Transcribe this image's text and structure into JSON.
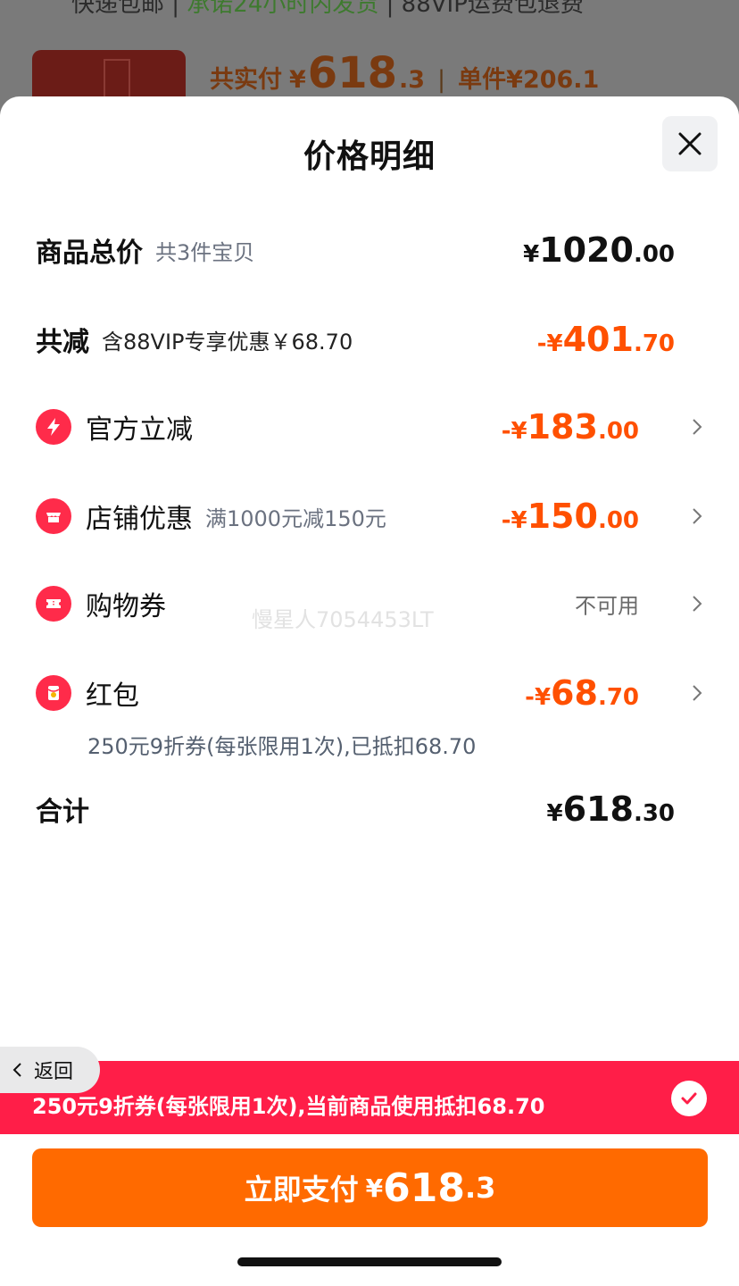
{
  "background": {
    "top_strip_text_a": "快递包邮 | ",
    "top_strip_text_green": "承诺24小时内发货",
    "top_strip_text_b": " | 88VIP运费包退费",
    "price_prefix": "共实付",
    "price_currency": "¥",
    "price_int": "618",
    "price_dec": ".3",
    "unit_label": "单件",
    "unit_price": "¥206.1"
  },
  "sheet": {
    "title": "价格明细",
    "close_icon": "close-icon"
  },
  "rows": {
    "total": {
      "label": "商品总价",
      "sub": "共3件宝贝",
      "cur": "¥",
      "int": "1020",
      "dec": ".00"
    },
    "reduce": {
      "label": "共减",
      "sub": "含88VIP专享优惠￥68.70",
      "cur": "-¥",
      "int": "401",
      "dec": ".70"
    },
    "official": {
      "label": "官方立减",
      "icon": "lightning-icon",
      "cur": "-¥",
      "int": "183",
      "dec": ".00"
    },
    "store": {
      "label": "店铺优惠",
      "sub": "满1000元减150元",
      "icon": "store-icon",
      "cur": "-¥",
      "int": "150",
      "dec": ".00"
    },
    "coupon": {
      "label": "购物券",
      "icon": "ticket-icon",
      "status": "不可用"
    },
    "redpacket": {
      "label": "红包",
      "icon": "red-packet-icon",
      "cur": "-¥",
      "int": "68",
      "dec": ".70",
      "note": "250元9折券(每张限用1次),已抵扣68.70"
    },
    "sum": {
      "label": "合计",
      "cur": "¥",
      "int": "618",
      "dec": ".30"
    }
  },
  "watermark": "慢星人7054453LT",
  "back": {
    "label": "返回"
  },
  "promo": {
    "text": "250元9折券(每张限用1次),当前商品使用抵扣68.70"
  },
  "pay": {
    "label": "立即支付",
    "cur": "¥",
    "int": "618",
    "dec": ".3"
  },
  "colors": {
    "accent_orange": "#ff5000",
    "pay_button": "#ff6a00",
    "promo_red": "#ff1e48",
    "icon_red": "#ff2b4a"
  }
}
